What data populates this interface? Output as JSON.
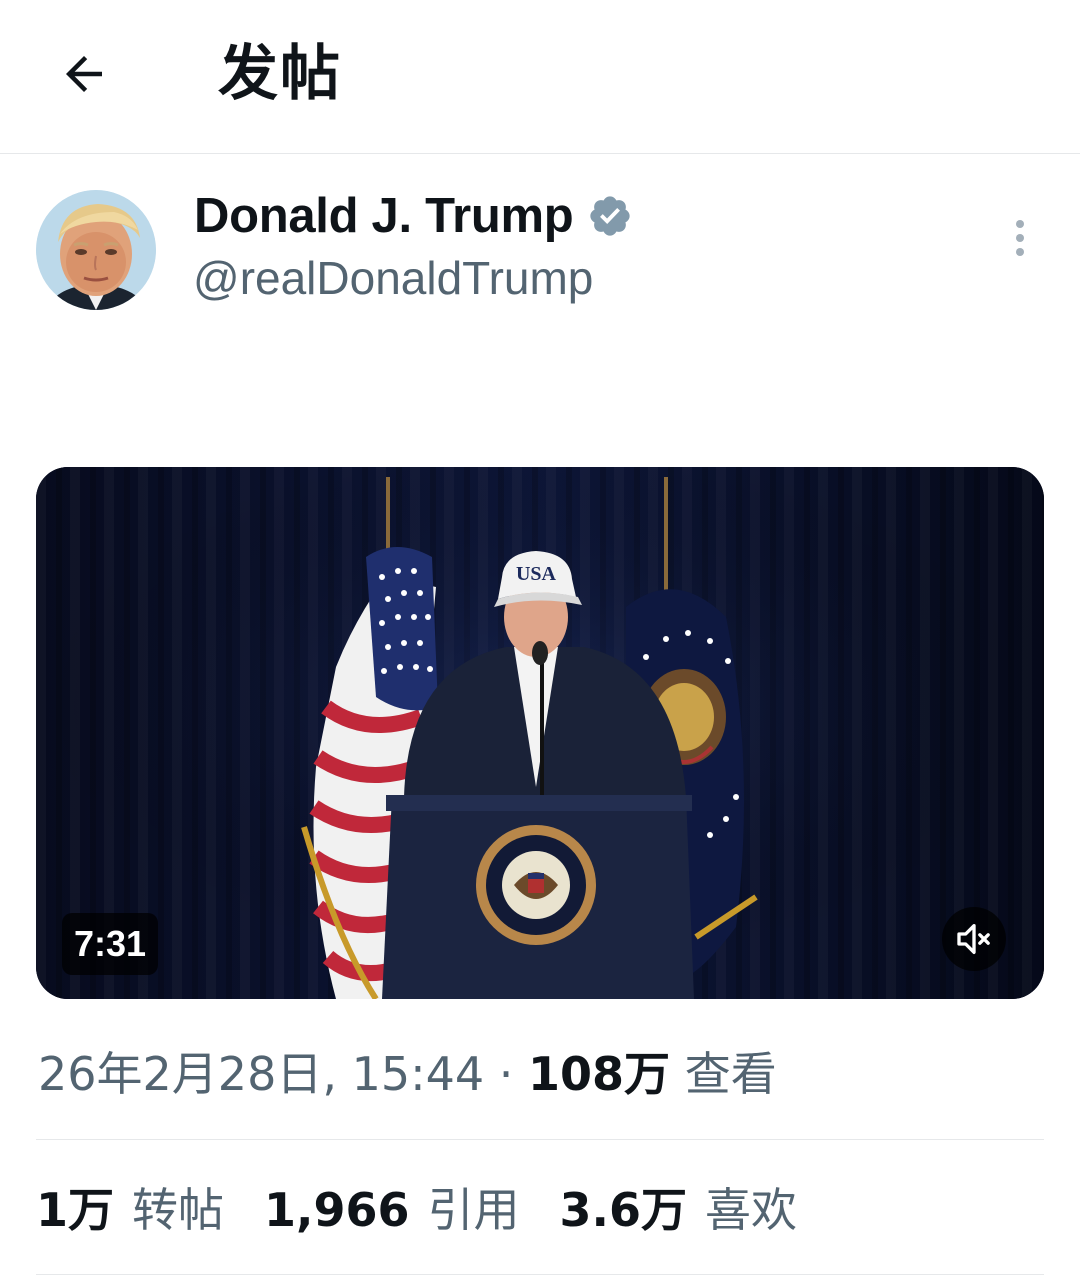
{
  "header": {
    "back_icon": "arrow-left-icon",
    "title": "发帖"
  },
  "author": {
    "name": "Donald J. Trump",
    "verified_icon": "verified-badge-icon",
    "handle": "@realDonaldTrump",
    "more_icon": "more-vertical-icon"
  },
  "video": {
    "duration": "7:31",
    "mute_icon": "speaker-muted-icon",
    "cap_text": "USA"
  },
  "meta": {
    "date": "26年2月28日, 15:44",
    "separator": "·",
    "views_count": "108万",
    "views_label": "查看"
  },
  "stats": [
    {
      "count": "1万",
      "label": "转帖"
    },
    {
      "count": "1,966",
      "label": "引用"
    },
    {
      "count": "3.6万",
      "label": "喜欢"
    }
  ],
  "colors": {
    "text_primary": "#0f1419",
    "text_secondary": "#536471",
    "badge": "#829aab",
    "divider": "#e6e8ea"
  }
}
